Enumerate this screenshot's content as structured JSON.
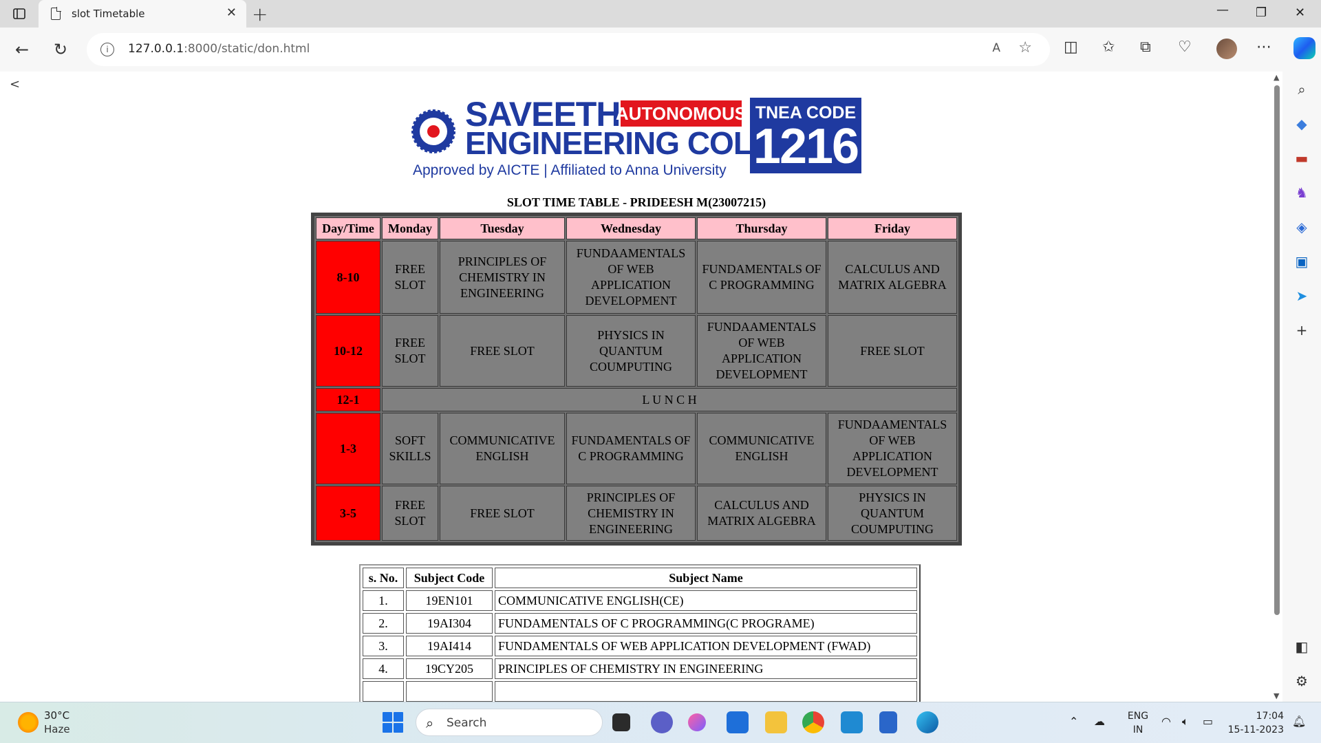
{
  "browser": {
    "tab_title": "slot Timetable",
    "url_host": "127.0.0.1",
    "url_path": ":8000/static/don.html",
    "read_aloud": "A",
    "new_tab": "+",
    "close_tab": "✕"
  },
  "page": {
    "back_link": "<",
    "logo": {
      "name_line1": "SAVEETHA",
      "badge": "AUTONOMOUS",
      "name_line2": "ENGINEERING COLLEGE",
      "tagline": "Approved by AICTE  |  Affiliated to Anna University",
      "tnea_label": "TNEA CODE",
      "tnea_code": "1216"
    },
    "timetable": {
      "title": "SLOT TIME TABLE - PRIDEESH M(23007215)",
      "headers": [
        "Day/Time",
        "Monday",
        "Tuesday",
        "Wednesday",
        "Thursday",
        "Friday"
      ],
      "rows": [
        {
          "time": "8-10",
          "cells": [
            "FREE SLOT",
            "PRINCIPLES OF CHEMISTRY IN ENGINEERING",
            "FUNDAAMENTALS OF WEB APPLICATION DEVELOPMENT",
            "FUNDAMENTALS OF C PROGRAMMING",
            "CALCULUS AND MATRIX ALGEBRA"
          ]
        },
        {
          "time": "10-12",
          "cells": [
            "FREE SLOT",
            "FREE SLOT",
            "PHYSICS IN QUANTUM COUMPUTING",
            "FUNDAAMENTALS OF WEB APPLICATION DEVELOPMENT",
            "FREE SLOT"
          ]
        },
        {
          "time": "12-1",
          "lunch": "L U N C H"
        },
        {
          "time": "1-3",
          "cells": [
            "SOFT SKILLS",
            "COMMUNICATIVE ENGLISH",
            "FUNDAMENTALS OF C PROGRAMMING",
            "COMMUNICATIVE ENGLISH",
            "FUNDAAMENTALS OF WEB APPLICATION DEVELOPMENT"
          ]
        },
        {
          "time": "3-5",
          "cells": [
            "FREE SLOT",
            "FREE SLOT",
            "PRINCIPLES OF CHEMISTRY IN ENGINEERING",
            "CALCULUS AND MATRIX ALGEBRA",
            "PHYSICS IN QUANTUM COUMPUTING"
          ]
        }
      ]
    },
    "subjects": {
      "headers": [
        "s. No.",
        "Subject Code",
        "Subject Name"
      ],
      "rows": [
        {
          "sno": "1.",
          "code": "19EN101",
          "name": "COMMUNICATIVE ENGLISH(CE)"
        },
        {
          "sno": "2.",
          "code": "19AI304",
          "name": "FUNDAMENTALS OF C PROGRAMMING(C PROGRAME)"
        },
        {
          "sno": "3.",
          "code": "19AI414",
          "name": "FUNDAMENTALS OF WEB APPLICATION DEVELOPMENT (FWAD)"
        },
        {
          "sno": "4.",
          "code": "19CY205",
          "name": "PRINCIPLES OF CHEMISTRY IN ENGINEERING"
        },
        {
          "sno": "",
          "code": "",
          "name": ""
        }
      ]
    }
  },
  "taskbar": {
    "weather_temp": "30°C",
    "weather_desc": "Haze",
    "search_placeholder": "Search",
    "lang_line1": "ENG",
    "lang_line2": "IN",
    "time": "17:04",
    "date": "15-11-2023"
  },
  "colors": {
    "time_cell": "#ff0000",
    "header_cell": "#ffc0cb",
    "body_cell": "#808080",
    "brand_blue": "#1f3aa0",
    "brand_red": "#e2161e"
  }
}
